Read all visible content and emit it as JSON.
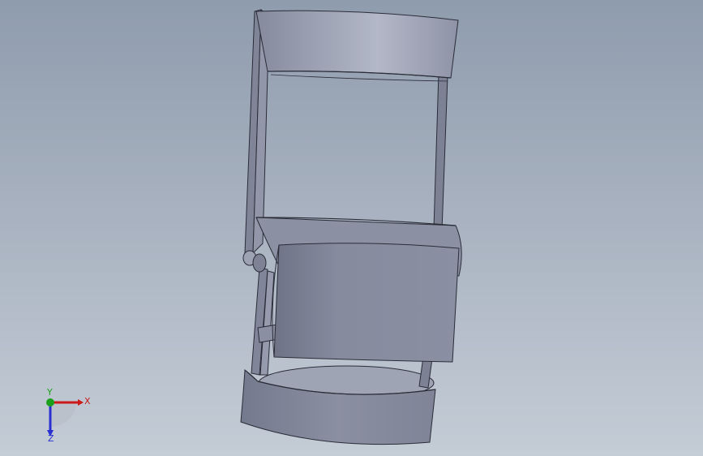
{
  "viewport": {
    "background_top": "#8f9cad",
    "background_bottom": "#c4ccd6"
  },
  "model": {
    "body_color": "#868b9e",
    "highlight_color": "#b3b8c8",
    "edge_color": "#2a2d38"
  },
  "triad": {
    "x_label": "X",
    "y_label": "Y",
    "z_label": "Z",
    "x_color": "#cc1a1a",
    "y_color": "#1aa01a",
    "z_color": "#2a2fd0"
  }
}
